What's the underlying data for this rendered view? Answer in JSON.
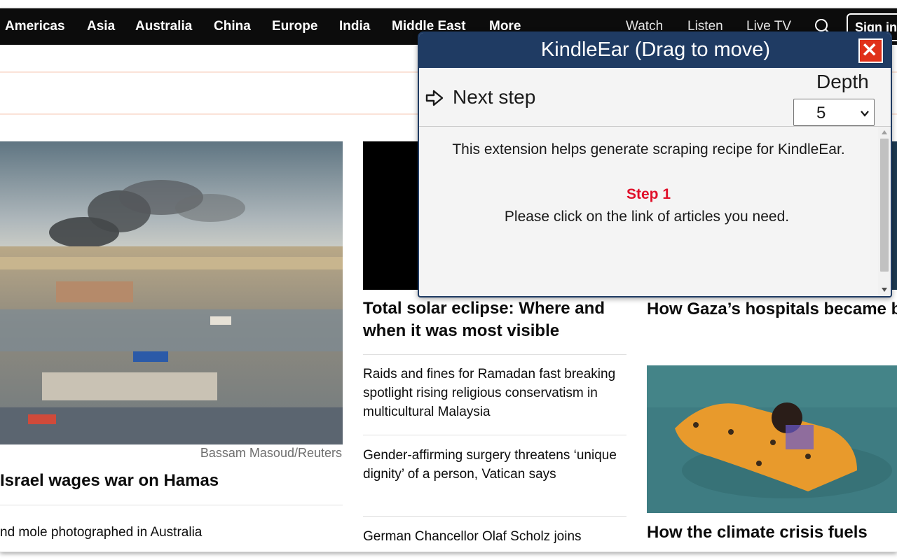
{
  "nav": {
    "regions": [
      "Americas",
      "Asia",
      "Australia",
      "China",
      "Europe",
      "India",
      "Middle East"
    ],
    "more_label": "More",
    "watch_label": "Watch",
    "listen_label": "Listen",
    "livetv_label": "Live TV",
    "signin_label": "Sign in",
    "search_icon": "search-icon"
  },
  "left": {
    "photo_credit": "Bassam Masoud/Reuters",
    "headline": "Israel wages war on Hamas",
    "story": "nd mole photographed in Australia"
  },
  "middle": {
    "headline": "Total solar eclipse: Where and when it was most visible",
    "stories": [
      "Raids and fines for Ramadan fast breaking spotlight rising religious conservatism in multicultural Malaysia",
      "Gender-affirming surgery threatens ‘unique dignity’ of a person, Vatican says",
      "German Chancellor Olaf Scholz joins"
    ]
  },
  "right": {
    "headline_1": "How Gaza’s hospitals became battlegrounds",
    "headline_2": "How the climate crisis fuels"
  },
  "popup": {
    "title": "KindleEar (Drag to move)",
    "next_step_label": "Next step",
    "depth_label": "Depth",
    "depth_value": "5",
    "intro": "This extension helps generate scraping recipe for KindleEar.",
    "step_title": "Step 1",
    "step_desc": "Please click on the link of articles you need.",
    "icons": [
      "close-icon",
      "arrow-right-icon",
      "chevron-down-icon"
    ]
  },
  "colors": {
    "nav_bg": "#0c0c0c",
    "popup_title_bg": "#1f3b63",
    "close_red": "#e0311a",
    "step_red": "#e0102a"
  }
}
